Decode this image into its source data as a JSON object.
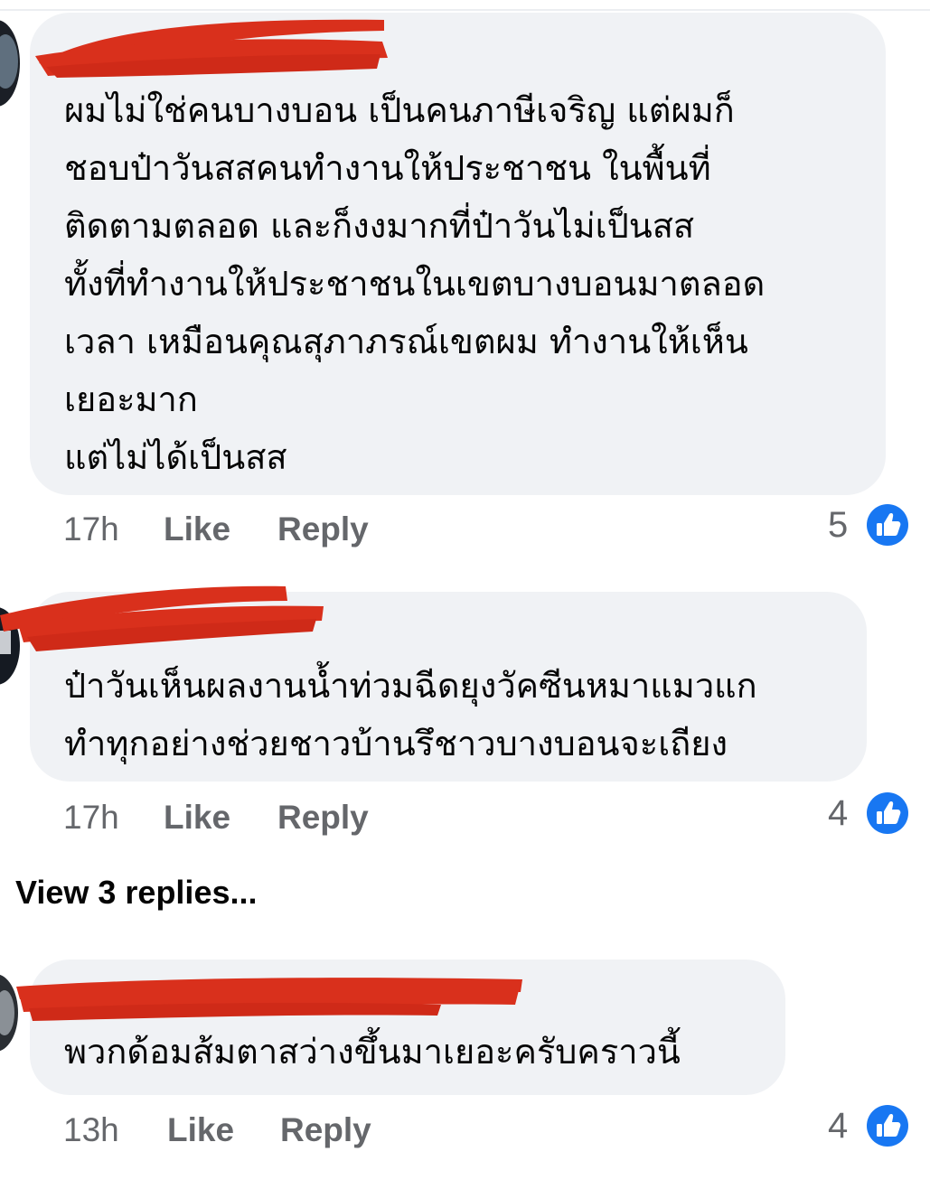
{
  "comments": [
    {
      "author": "",
      "text": "ผมไม่ใช่คนบางบอน เป็นคนภาษีเจริญ  แต่ผมก็\nชอบป๋าวันสสคนทำงานให้ประชาชน ในพื้นที่\nติดตามตลอด  และก็งงมากที่ป๋าวันไม่เป็นสส\nทั้งที่ทำงานให้ประชาชนในเขตบางบอนมาตลอด\nเวลา  เหมือนคุณสุภาภรณ์เขตผม  ทำงานให้เห็น\nเยอะมาก\nแต่ไม่ได้เป็นสส",
      "time": "17h",
      "like_label": "Like",
      "reply_label": "Reply",
      "like_count": "5"
    },
    {
      "author": "",
      "text": "ป๋าวันเห็นผลงานน้ำท่วมฉีดยุงวัคซีนหมาแมวแก\nทำทุกอย่างช่วยชาวบ้านรึชาวบางบอนจะเถียง",
      "time": "17h",
      "like_label": "Like",
      "reply_label": "Reply",
      "like_count": "4"
    },
    {
      "author": "",
      "text": "พวกด้อมส้มตาสว่างขึ้นมาเยอะครับคราวนี้",
      "time": "13h",
      "like_label": "Like",
      "reply_label": "Reply",
      "like_count": "4"
    }
  ],
  "view_replies_label": "View 3 replies...",
  "icons": {
    "reaction": "like-reaction-icon",
    "redaction": "red-scribble-redaction"
  },
  "colors": {
    "bubble": "#f0f2f5",
    "text": "#050505",
    "meta": "#65676b",
    "like_blue": "#1877f2",
    "redaction": "#d9301c"
  }
}
